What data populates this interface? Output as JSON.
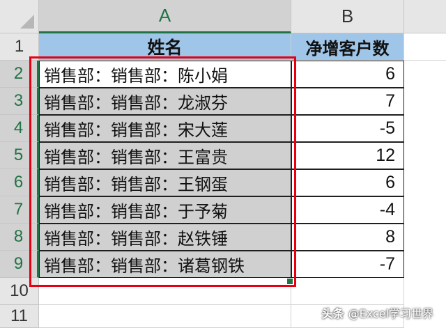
{
  "columns": {
    "a": "A",
    "b": "B"
  },
  "row_numbers": [
    "1",
    "2",
    "3",
    "4",
    "5",
    "6",
    "7",
    "8",
    "9",
    "10",
    "11"
  ],
  "headers": {
    "name": "姓名",
    "net_growth": "净增客户数"
  },
  "rows": [
    {
      "name": "销售部：销售部：陈小娟",
      "value": "6"
    },
    {
      "name": "销售部：销售部：龙淑芬",
      "value": "7"
    },
    {
      "name": "销售部：销售部：宋大莲",
      "value": "-5"
    },
    {
      "name": "销售部：销售部：王富贵",
      "value": "12"
    },
    {
      "name": "销售部：销售部：王钢蛋",
      "value": "6"
    },
    {
      "name": "销售部：销售部：于予菊",
      "value": "-4"
    },
    {
      "name": "销售部：销售部：赵铁锤",
      "value": "8"
    },
    {
      "name": "销售部：销售部：诸葛钢铁",
      "value": "-7"
    }
  ],
  "watermark": {
    "logo": "头条",
    "text": "@Excel学习世界"
  },
  "colors": {
    "header_fill": "#9fc5e8",
    "selection_fill": "#d0d0d0",
    "highlight_frame": "#e60012",
    "excel_green": "#217346"
  }
}
